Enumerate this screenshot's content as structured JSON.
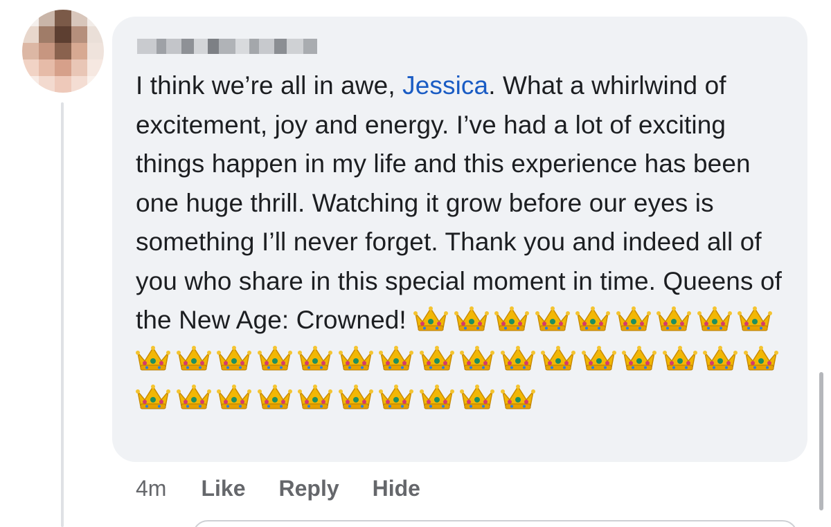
{
  "comment": {
    "author_name": "",
    "text_before_mention": "I think we’re all in awe, ",
    "mention": "Jessica",
    "text_after_mention": ". What a whirlwind of excitement, joy and energy. I’ve had a lot of exciting things happen in my life and this experience has been one huge thrill. Watching it grow before our eyes is something I’ll never forget. Thank you and indeed all of you who share in this special moment in time. Queens of the New Age: Crowned!",
    "crown_count": 35,
    "crown_emoji_icon": "crown-icon"
  },
  "actions": {
    "timestamp": "4m",
    "like_label": "Like",
    "reply_label": "Reply",
    "hide_label": "Hide"
  },
  "colors": {
    "bubble_background": "#f0f2f5",
    "mention_color": "#1a5cc4",
    "action_text_color": "#65676b",
    "body_text_color": "#1c1e21"
  }
}
